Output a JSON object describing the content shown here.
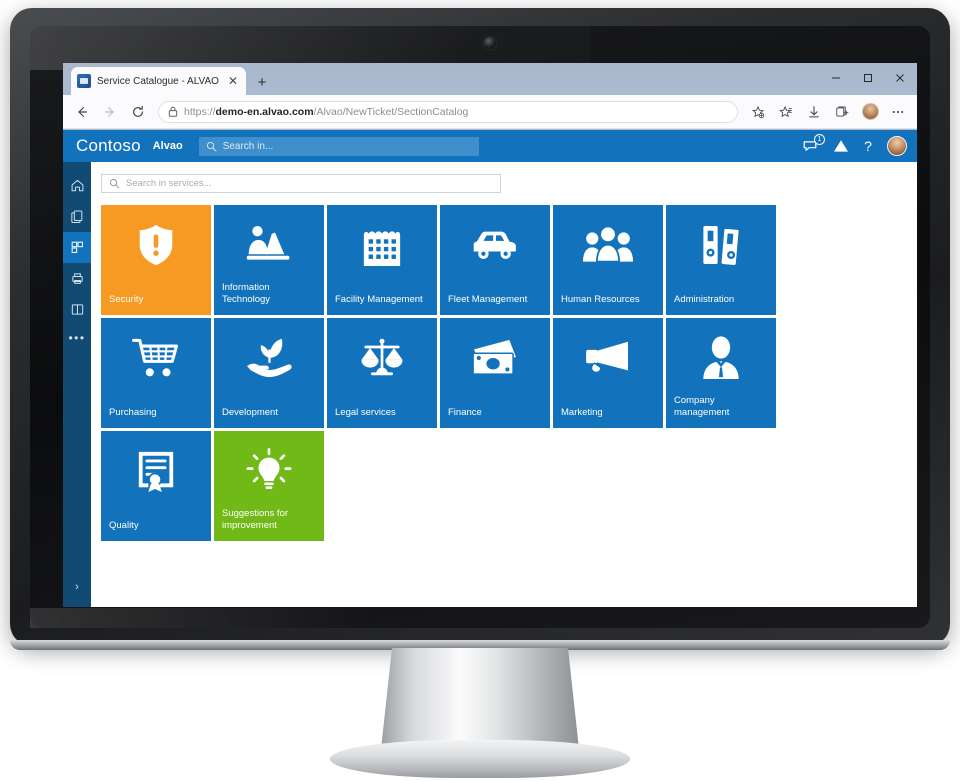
{
  "browser": {
    "tab_title": "Service Catalogue - ALVAO",
    "tab_close_label": "✕",
    "new_tab_label": "+",
    "url_scheme": "https://",
    "url_domain": "demo-en.alvao.com",
    "url_path": "/Alvao/NewTicket/SectionCatalog",
    "window_minimize": "—",
    "window_maximize": "▫",
    "window_close": "✕"
  },
  "app_header": {
    "brand": "Contoso",
    "brand_sub": "Alvao",
    "search_placeholder": "Search in...",
    "notification_badge": "1"
  },
  "sidebar": {
    "items": [
      {
        "name": "home",
        "label": "Home"
      },
      {
        "name": "requests",
        "label": "Requests"
      },
      {
        "name": "catalog",
        "label": "Service Catalogue"
      },
      {
        "name": "devices",
        "label": "Devices"
      },
      {
        "name": "knowledge",
        "label": "Knowledge Base"
      }
    ],
    "more_label": "•••",
    "expand_label": "›"
  },
  "content": {
    "search_placeholder": "Search in services...",
    "tiles": [
      {
        "label": "Security",
        "icon": "shield-alert-icon",
        "color": "orange"
      },
      {
        "label": "Information Technology",
        "icon": "person-laptop-icon",
        "color": "blue"
      },
      {
        "label": "Facility Management",
        "icon": "building-icon",
        "color": "blue"
      },
      {
        "label": "Fleet Management",
        "icon": "car-icon",
        "color": "blue"
      },
      {
        "label": "Human Resources",
        "icon": "people-group-icon",
        "color": "blue"
      },
      {
        "label": "Administration",
        "icon": "binders-icon",
        "color": "blue"
      },
      {
        "label": "Purchasing",
        "icon": "shopping-cart-icon",
        "color": "blue"
      },
      {
        "label": "Development",
        "icon": "hand-plant-icon",
        "color": "blue"
      },
      {
        "label": "Legal services",
        "icon": "scales-icon",
        "color": "blue"
      },
      {
        "label": "Finance",
        "icon": "money-icon",
        "color": "blue"
      },
      {
        "label": "Marketing",
        "icon": "megaphone-icon",
        "color": "blue"
      },
      {
        "label": "Company management",
        "icon": "businessperson-icon",
        "color": "blue"
      },
      {
        "label": "Quality",
        "icon": "certificate-icon",
        "color": "blue"
      },
      {
        "label": "Suggestions for improvement",
        "icon": "lightbulb-icon",
        "color": "green"
      }
    ]
  },
  "colors": {
    "tile_blue": "#1273bc",
    "tile_orange": "#f79a23",
    "tile_green": "#70b916",
    "header_blue": "#1273bc",
    "sidebar_blue": "#114a72"
  }
}
